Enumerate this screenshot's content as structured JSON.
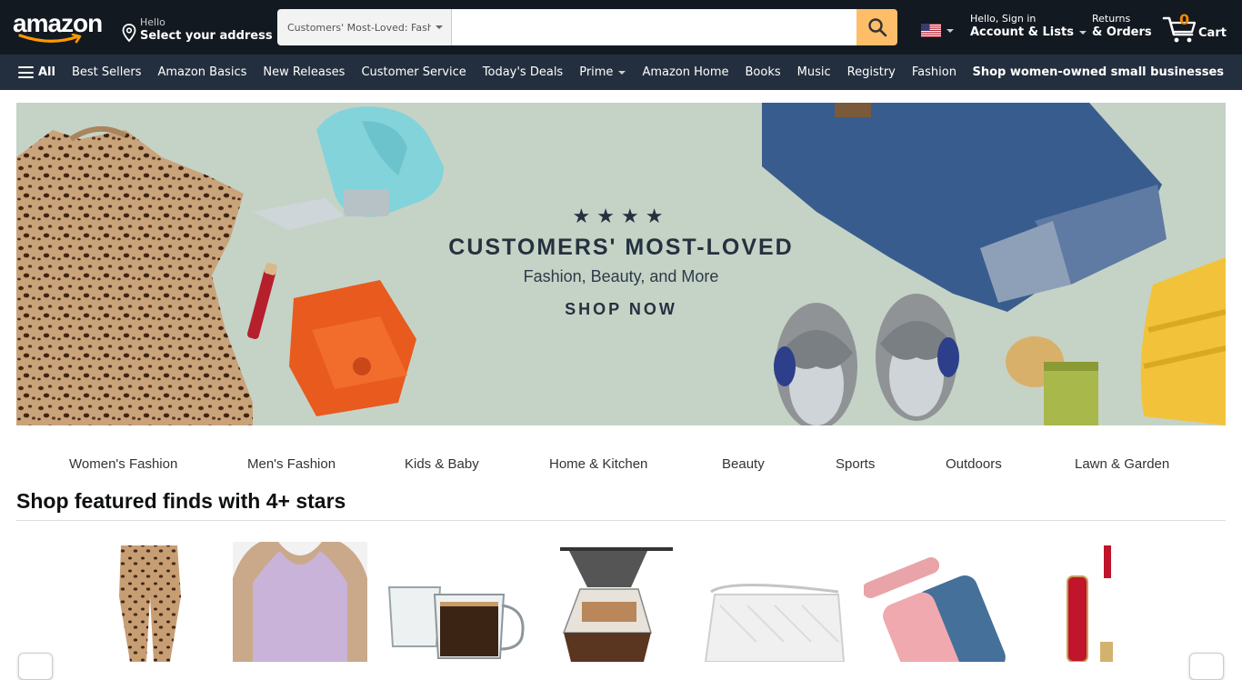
{
  "header": {
    "logo_text": "amazon",
    "address": {
      "hello": "Hello",
      "select": "Select your address"
    },
    "search": {
      "department": "Customers' Most-Loved: Fashion, Beauty & More",
      "placeholder": ""
    },
    "account": {
      "hello": "Hello, Sign in",
      "label": "Account & Lists"
    },
    "returns": {
      "line1": "Returns",
      "line2": "& Orders"
    },
    "cart": {
      "count": "0",
      "label": "Cart"
    }
  },
  "subnav": {
    "all_label": "All",
    "links": [
      "Best Sellers",
      "Amazon Basics",
      "New Releases",
      "Customer Service",
      "Today's Deals",
      "Prime",
      "Amazon Home",
      "Books",
      "Music",
      "Registry",
      "Fashion"
    ],
    "promo": "Shop women-owned small businesses"
  },
  "hero": {
    "stars": "★★★★",
    "title": "CUSTOMERS' MOST-LOVED",
    "subtitle": "Fashion, Beauty, and More",
    "cta": "SHOP NOW"
  },
  "categories": [
    "Women's Fashion",
    "Men's Fashion",
    "Kids & Baby",
    "Home & Kitchen",
    "Beauty",
    "Sports",
    "Outdoors",
    "Lawn & Garden"
  ],
  "featured": {
    "title": "Shop featured finds with 4+ stars"
  },
  "colors": {
    "nav_dark": "#131921",
    "nav_sub": "#232f3e",
    "search_button": "#febd69",
    "cart_count": "#f08804"
  }
}
